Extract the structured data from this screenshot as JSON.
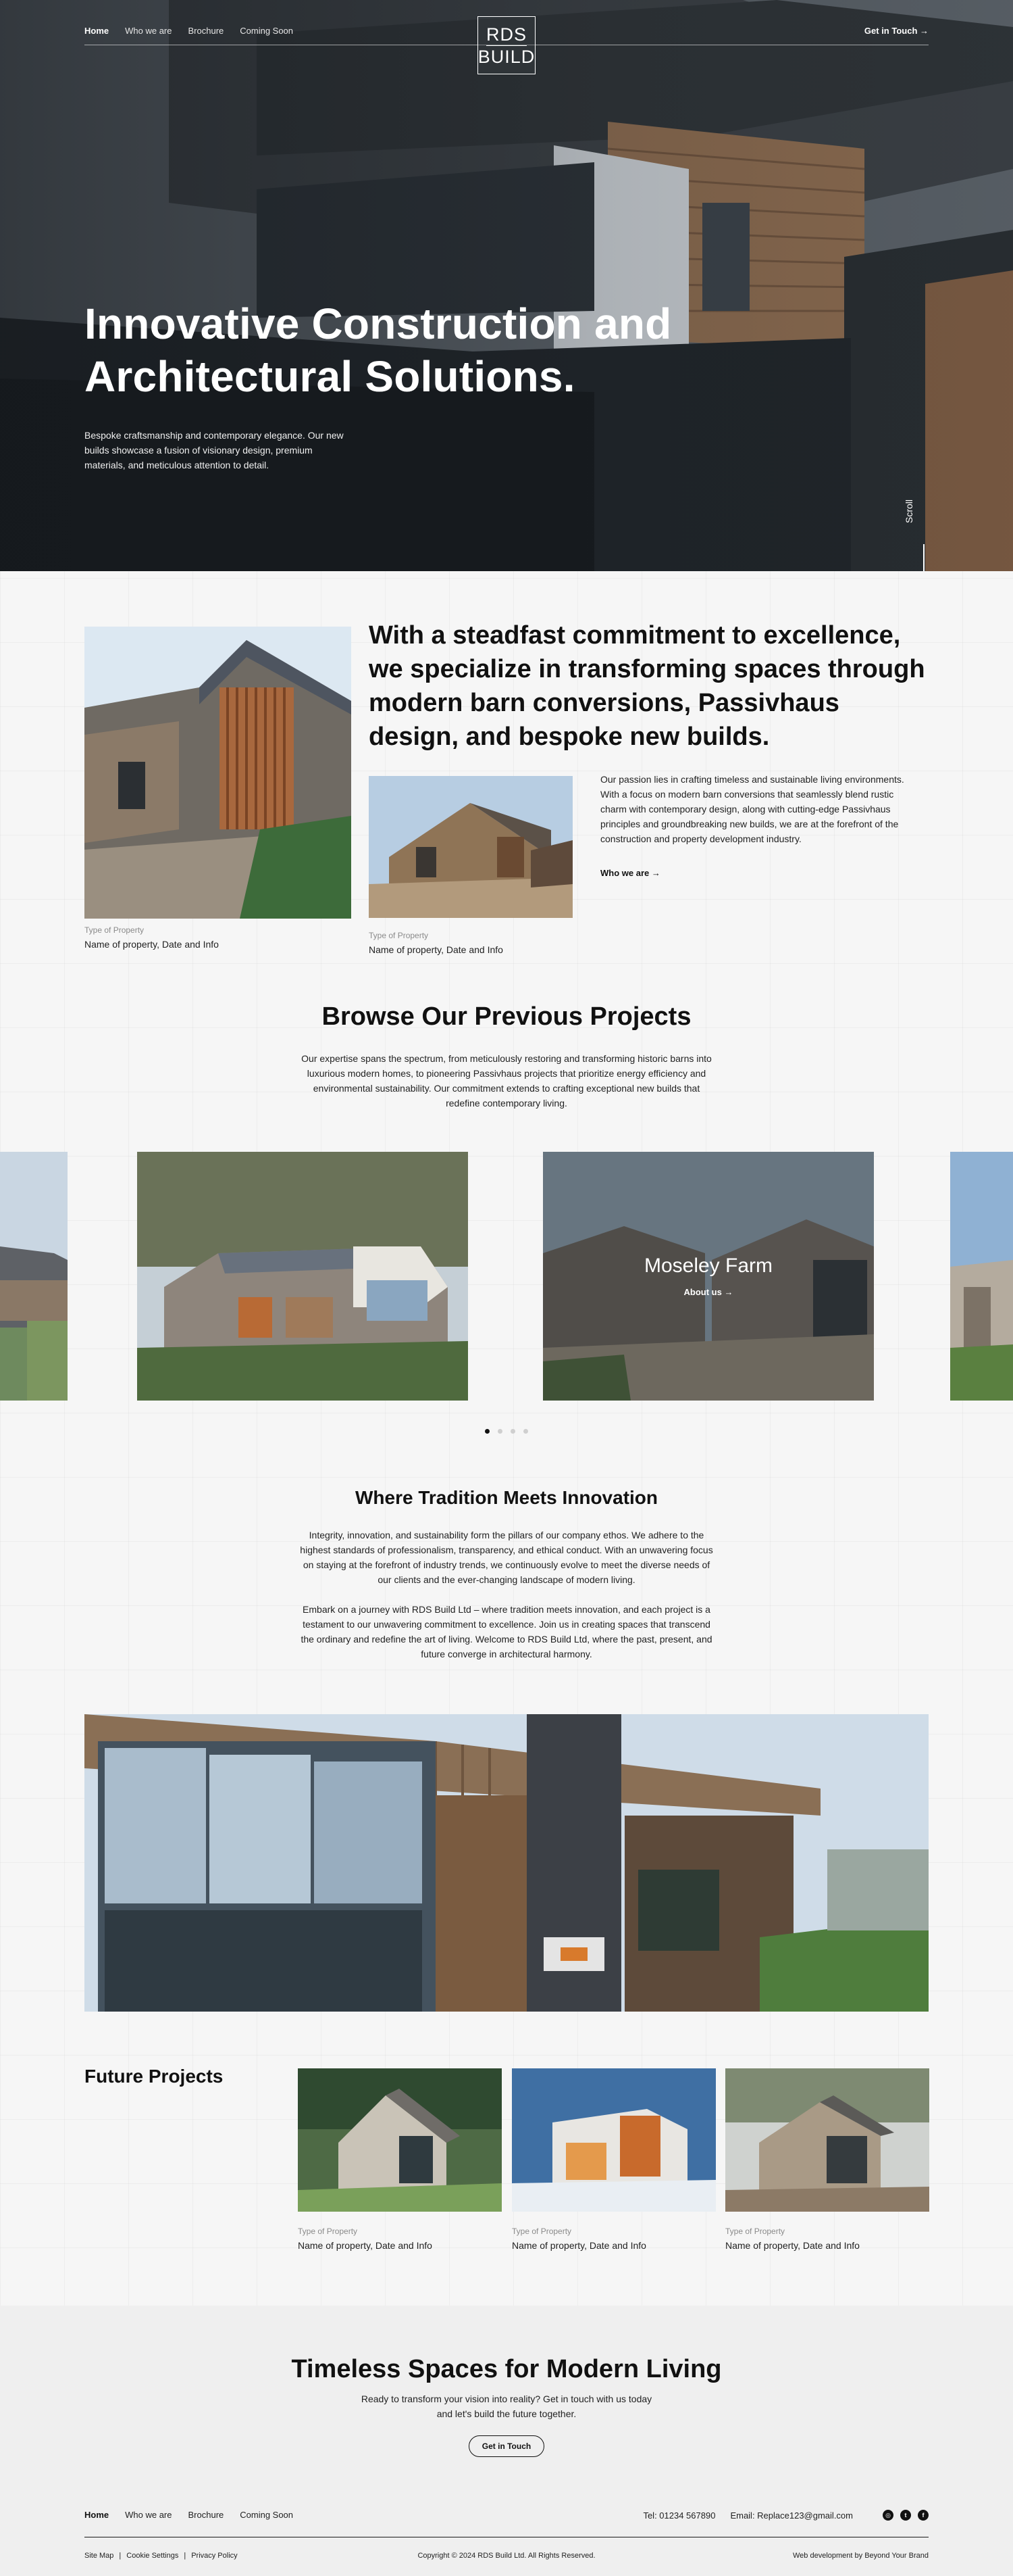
{
  "nav": {
    "links": [
      "Home",
      "Who we are",
      "Brochure",
      "Coming Soon"
    ],
    "logo_line1": "RDS",
    "logo_line2": "BUILD",
    "cta": "Get in Touch →"
  },
  "hero": {
    "title": "Innovative Construction and Architectural Solutions.",
    "subtitle": "Bespoke craftsmanship and contemporary elegance. Our new builds showcase a fusion of visionary design, premium materials, and meticulous attention to detail.",
    "scroll_label": "Scroll"
  },
  "intro": {
    "headline": "With a steadfast commitment to excellence, we specialize in transforming spaces through modern barn conversions, Passivhaus design, and bespoke new builds.",
    "body": "Our passion lies in crafting timeless and sustainable living environments. With a focus on modern barn conversions that seamlessly blend rustic charm with contemporary design, along with cutting-edge Passivhaus principles and groundbreaking new builds, we are at the forefront of the construction and property development industry.",
    "link": "Who we are →",
    "card1": {
      "type": "Type of Property",
      "name": "Name of property, Date and Info"
    },
    "card2": {
      "type": "Type of Property",
      "name": "Name of property, Date and Info"
    }
  },
  "projects": {
    "title": "Browse Our Previous Projects",
    "body": "Our expertise spans the spectrum, from meticulously restoring and transforming historic barns into luxurious modern homes, to pioneering Passivhaus projects that prioritize energy efficiency and environmental sustainability. Our commitment extends to crafting exceptional new builds that redefine contemporary living.",
    "active_slide": {
      "title": "Moseley Farm",
      "link": "About us →"
    },
    "slide_count": 4,
    "active_index": 0
  },
  "tradition": {
    "title": "Where Tradition Meets Innovation",
    "p1": "Integrity, innovation, and sustainability form the pillars of our company ethos. We adhere to the highest standards of professionalism, transparency, and ethical conduct. With an unwavering focus on staying at the forefront of industry trends, we continuously evolve to meet the diverse needs of our clients and the ever-changing landscape of modern living.",
    "p2": "Embark on a journey with RDS Build Ltd – where tradition meets innovation, and each project is a testament to our unwavering commitment to excellence. Join us in creating spaces that transcend the ordinary and redefine the art of living. Welcome to RDS Build Ltd, where the past, present, and future converge in architectural harmony."
  },
  "future": {
    "title": "Future Projects",
    "cards": [
      {
        "type": "Type of Property",
        "name": "Name of property, Date and Info"
      },
      {
        "type": "Type of Property",
        "name": "Name of property, Date and Info"
      },
      {
        "type": "Type of Property",
        "name": "Name of property, Date and Info"
      }
    ]
  },
  "cta": {
    "title": "Timeless Spaces for Modern Living",
    "body": "Ready to transform your vision into reality? Get in touch with us today and let's build the future together.",
    "button": "Get in Touch"
  },
  "footer": {
    "links": [
      "Home",
      "Who we are",
      "Brochure",
      "Coming Soon"
    ],
    "tel": "Tel: 01234 567890",
    "email": "Email: Replace123@gmail.com",
    "socials": [
      "instagram-icon",
      "twitter-icon",
      "facebook-icon"
    ],
    "legal": [
      "Site Map",
      "Cookie Settings",
      "Privacy Policy"
    ],
    "legal_sep": "|",
    "copyright": "Copyright © 2024 RDS Build Ltd. All Rights Reserved.",
    "credit": "Web development by Beyond Your Brand"
  },
  "colors": {
    "accent": "#111111",
    "background": "#f6f6f6",
    "cta_background": "#efefef"
  }
}
